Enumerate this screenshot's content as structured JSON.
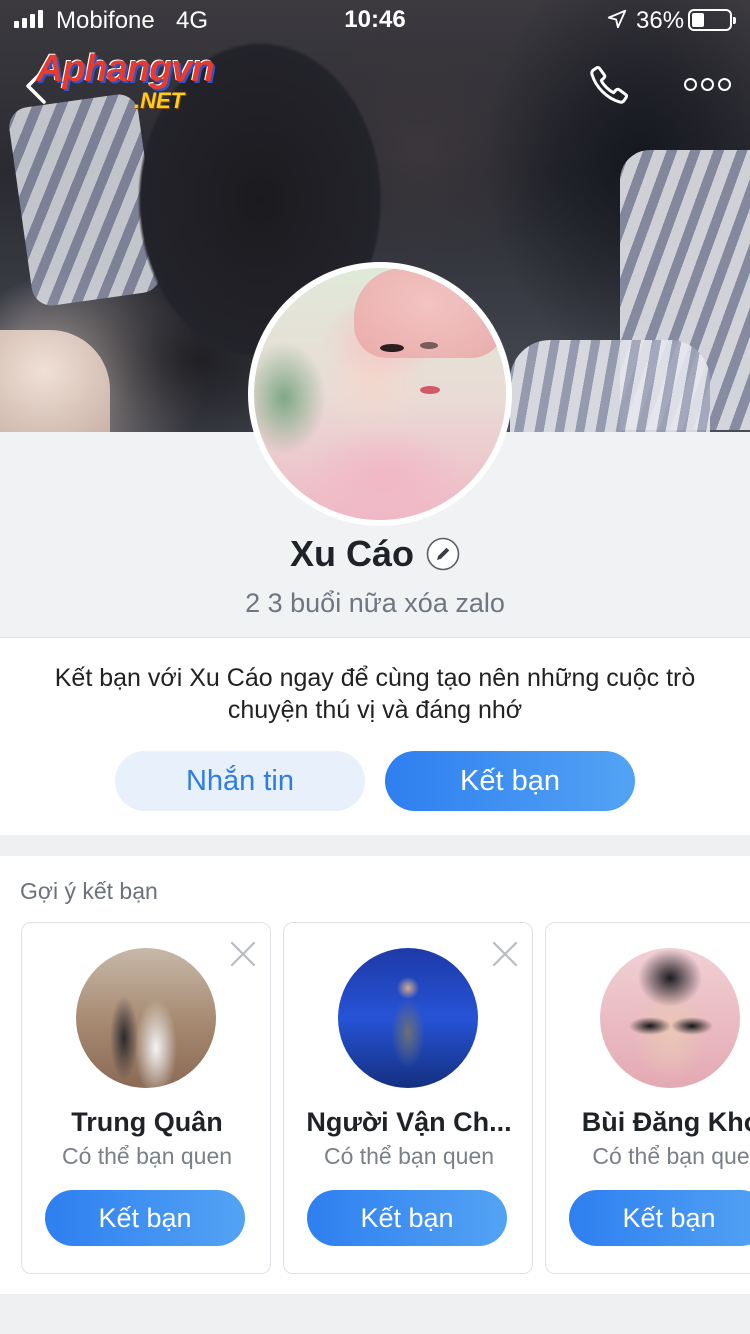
{
  "status_bar": {
    "carrier": "Mobifone",
    "network": "4G",
    "time": "10:46",
    "battery": "36%",
    "battery_level": 0.36,
    "icons": [
      "signal-bars-icon",
      "location-arrow-icon",
      "battery-icon"
    ]
  },
  "watermark": {
    "main": "Aphangvn",
    "sub": ".NET"
  },
  "nav": {
    "icons": [
      "back-chevron-icon",
      "phone-icon",
      "more-dots-icon"
    ]
  },
  "profile": {
    "name": "Xu Cáo",
    "status": "2 3 buổi nữa xóa zalo"
  },
  "invite": {
    "text": "Kết bạn với Xu Cáo ngay để cùng tạo nên những cuộc trò chuyện thú vị và đáng nhớ",
    "message_label": "Nhắn tin",
    "add_friend_label": "Kết bạn"
  },
  "suggestions": {
    "title": "Gợi ý kết bạn",
    "items": [
      {
        "name": "Trung Quân",
        "subtitle": "Có thể bạn quen",
        "button": "Kết bạn",
        "dismissable": true
      },
      {
        "name": "Người Vận Ch...",
        "subtitle": "Có thể bạn quen",
        "button": "Kết bạn",
        "dismissable": true
      },
      {
        "name": "Bùi Đăng Kho",
        "subtitle": "Có thể bạn que",
        "button": "Kết bạn",
        "dismissable": false
      }
    ]
  },
  "colors": {
    "accent": "#2e7ff0",
    "accent_light": "#e7f0fb",
    "background": "#eef0f2"
  }
}
